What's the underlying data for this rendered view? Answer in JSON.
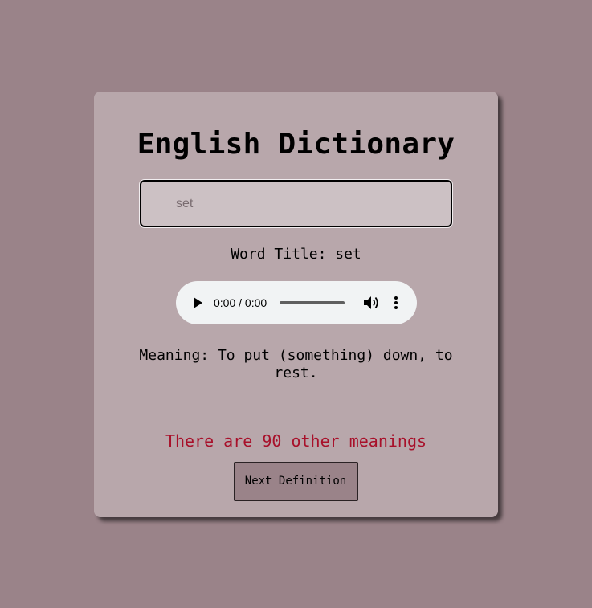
{
  "app": {
    "title": "English Dictionary"
  },
  "search": {
    "placeholder": "set",
    "value": ""
  },
  "word": {
    "title_text": "Word Title: set"
  },
  "audio": {
    "time_text": "0:00 / 0:00",
    "play_icon": "play-icon",
    "volume_icon": "volume-icon",
    "more_icon": "more-vert-icon"
  },
  "definition": {
    "meaning_text": "Meaning: To put (something) down, to rest."
  },
  "other_meanings": {
    "text": "There are 90 other meanings"
  },
  "buttons": {
    "next_label": "Next Definition"
  },
  "colors": {
    "page_background": "#9a8389",
    "card_background": "#b8a7ab",
    "input_background": "#ccc1c4",
    "other_meanings_text": "#a8102a",
    "button_background": "#9a8389"
  }
}
